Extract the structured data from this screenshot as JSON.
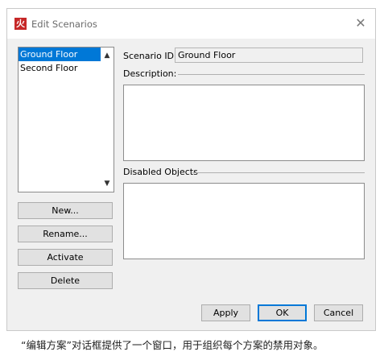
{
  "window": {
    "title": "Edit Scenarios",
    "app_icon_glyph": "火",
    "close_glyph": "✕"
  },
  "scenarios": {
    "items": [
      {
        "label": "Ground Floor",
        "selected": true
      },
      {
        "label": "Second Floor",
        "selected": false
      }
    ],
    "scroll_up_glyph": "▲",
    "scroll_down_glyph": "▼"
  },
  "buttons": {
    "new": "New...",
    "rename": "Rename...",
    "activate": "Activate",
    "delete": "Delete",
    "apply": "Apply",
    "ok": "OK",
    "cancel": "Cancel"
  },
  "form": {
    "scenario_id_label": "Scenario ID:",
    "scenario_id_value": "Ground Floor",
    "description_label": "Description:",
    "description_value": "",
    "disabled_objects_label": "Disabled Objects"
  },
  "caption": "“编辑方案”对话框提供了一个窗口，用于组织每个方案的禁用对象。",
  "colors": {
    "selection": "#0078d7",
    "app_icon": "#c62828"
  }
}
